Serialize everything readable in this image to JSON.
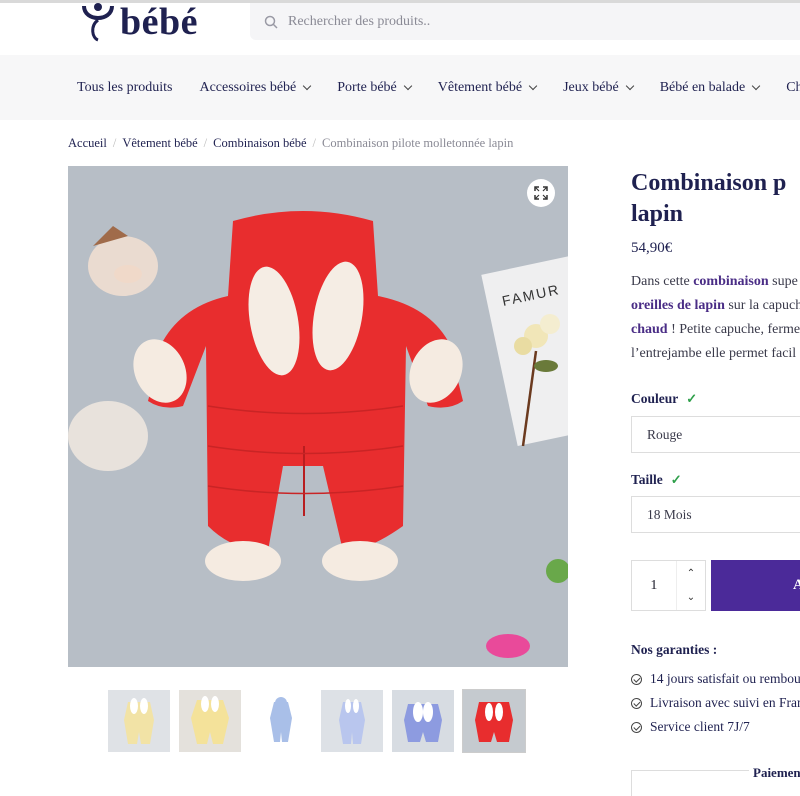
{
  "header": {
    "logo_text": "bébé",
    "search_placeholder": "Rechercher des produits.."
  },
  "nav": {
    "items": [
      {
        "label": "Tous les produits",
        "has_dropdown": false
      },
      {
        "label": "Accessoires bébé",
        "has_dropdown": true
      },
      {
        "label": "Porte bébé",
        "has_dropdown": true
      },
      {
        "label": "Vêtement bébé",
        "has_dropdown": true
      },
      {
        "label": "Jeux bébé",
        "has_dropdown": true
      },
      {
        "label": "Bébé en balade",
        "has_dropdown": true
      },
      {
        "label": "Ch",
        "has_dropdown": false
      }
    ]
  },
  "breadcrumb": [
    "Accueil",
    "Vêtement bébé",
    "Combinaison bébé",
    "Combinaison pilote molletonnée lapin"
  ],
  "product": {
    "title_line1": "Combinaison p",
    "title_line2": "lapin",
    "price": "54,90€",
    "desc_l1_a": "Dans cette ",
    "desc_l1_b": "combinaison",
    "desc_l1_c": " supe",
    "desc_l2_a": "oreilles de lapin",
    "desc_l2_b": " sur la capuch",
    "desc_l3_a": "chaud",
    "desc_l3_b": " ! Petite capuche, ferme",
    "desc_l4": "l’entrejambe elle permet facil",
    "color_label": "Couleur",
    "color_value": "Rouge",
    "size_label": "Taille",
    "size_value": "18 Mois",
    "quantity": "1",
    "add_label": "A",
    "guarantees_title": "Nos garanties :",
    "guarantees": [
      "14 jours satisfait ou rembou",
      "Livraison avec suivi en Fran",
      "Service client 7J/7"
    ],
    "payment_label": "Paiement"
  },
  "colors": {
    "brand": "#1f2150",
    "accent": "#4b2a99",
    "check": "#2e9f4a"
  },
  "thumbnails": [
    {
      "color": "yellow"
    },
    {
      "color": "yellow"
    },
    {
      "color": "blue"
    },
    {
      "color": "blue"
    },
    {
      "color": "blue"
    },
    {
      "color": "red"
    }
  ]
}
